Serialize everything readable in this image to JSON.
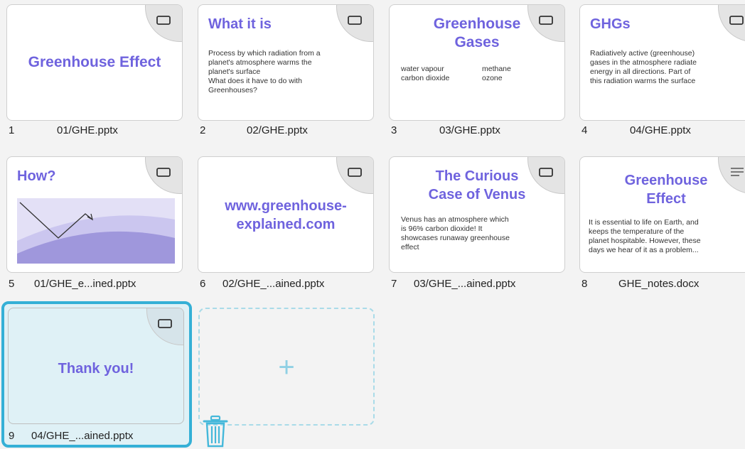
{
  "slides": [
    {
      "num": "1",
      "file": "01/GHE.pptx",
      "title": "Greenhouse Effect",
      "icon": "slide-icon"
    },
    {
      "num": "2",
      "file": "02/GHE.pptx",
      "title": "What it is",
      "body": [
        "Process by which radiation from a",
        "planet's atmosphere warms the",
        "planet's surface",
        "What does it have to do with",
        "Greenhouses?"
      ],
      "icon": "slide-icon"
    },
    {
      "num": "3",
      "file": "03/GHE.pptx",
      "title_lines": [
        "Greenhouse",
        "Gases"
      ],
      "cols": [
        [
          "water vapour",
          "carbon dioxide"
        ],
        [
          "methane",
          "ozone"
        ]
      ],
      "icon": "slide-icon"
    },
    {
      "num": "4",
      "file": "04/GHE.pptx",
      "title": "GHGs",
      "body": [
        "Radiatively active (greenhouse)",
        "gases in the atmosphere radiate",
        "energy in all directions. Part of",
        "this radiation warms the surface"
      ],
      "icon": "slide-icon"
    },
    {
      "num": "5",
      "file": "01/GHE_e...ined.pptx",
      "title": "How?",
      "icon": "slide-icon"
    },
    {
      "num": "6",
      "file": "02/GHE_...ained.pptx",
      "title_lines": [
        "www.greenhouse-",
        "explained.com"
      ],
      "icon": "slide-icon"
    },
    {
      "num": "7",
      "file": "03/GHE_...ained.pptx",
      "title_lines": [
        "The Curious",
        "Case of Venus"
      ],
      "body": [
        "Venus has an atmosphere which",
        "is 96% carbon dioxide! It",
        "showcases runaway greenhouse",
        "effect"
      ],
      "icon": "slide-icon"
    },
    {
      "num": "8",
      "file": "GHE_notes.docx",
      "title_lines": [
        "Greenhouse",
        "Effect"
      ],
      "body": [
        "It is essential to life on Earth, and",
        "keeps the temperature of the",
        "planet hospitable. However, these",
        "days we hear of it as a problem..."
      ],
      "icon": "document-icon"
    },
    {
      "num": "9",
      "file": "04/GHE_...ained.pptx",
      "title": "Thank you!",
      "icon": "slide-icon",
      "selected": true
    }
  ],
  "add_button": {
    "label": "+"
  },
  "colors": {
    "accent": "#6f63de",
    "selection": "#35b0d6",
    "add_dash": "#a9dbe8"
  }
}
